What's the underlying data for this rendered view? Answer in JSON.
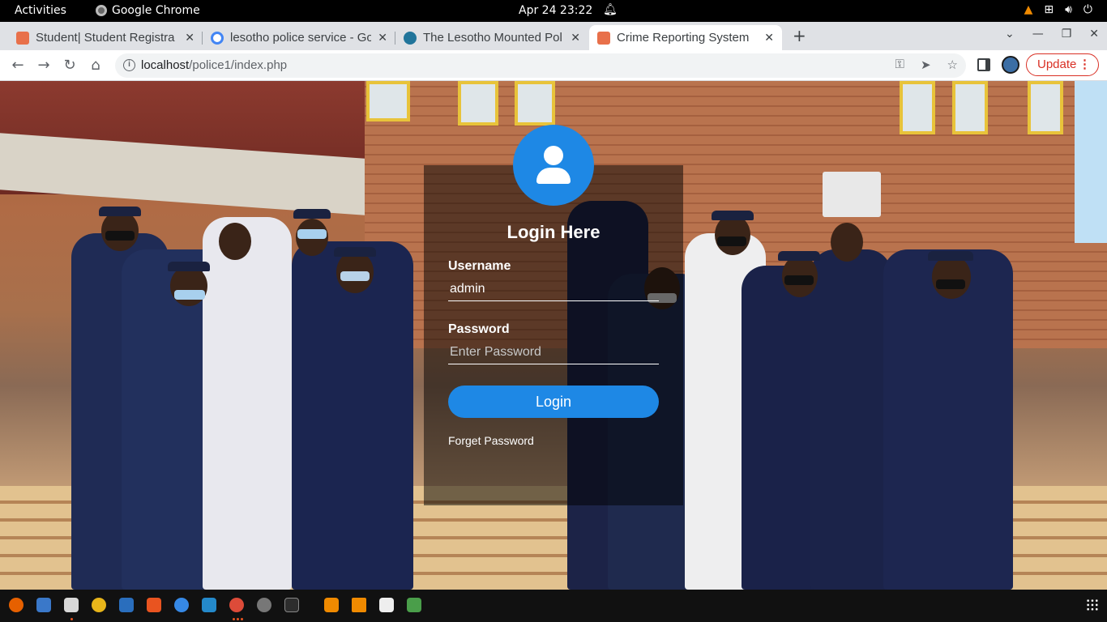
{
  "topbar": {
    "activities": "Activities",
    "app_name": "Google Chrome",
    "clock": "Apr 24  23:22"
  },
  "tabs": [
    {
      "title": "Student| Student Registra",
      "favicon_color": "#e8704a"
    },
    {
      "title": "lesotho police service - Go",
      "favicon_color": "#4285f4"
    },
    {
      "title": "The Lesotho Mounted Pol",
      "favicon_color": "#21759b"
    },
    {
      "title": "Crime Reporting System",
      "favicon_color": "#e8704a",
      "active": true
    }
  ],
  "toolbar": {
    "url_host": "localhost",
    "url_path": "/police1/index.php",
    "update_label": "Update"
  },
  "login": {
    "title": "Login Here",
    "username_label": "Username",
    "username_value": "admin",
    "password_label": "Password",
    "password_placeholder": "Enter Password",
    "login_button": "Login",
    "forgot_link": "Forget Password"
  },
  "colors": {
    "accent": "#1e88e5",
    "update_red": "#d93025"
  }
}
